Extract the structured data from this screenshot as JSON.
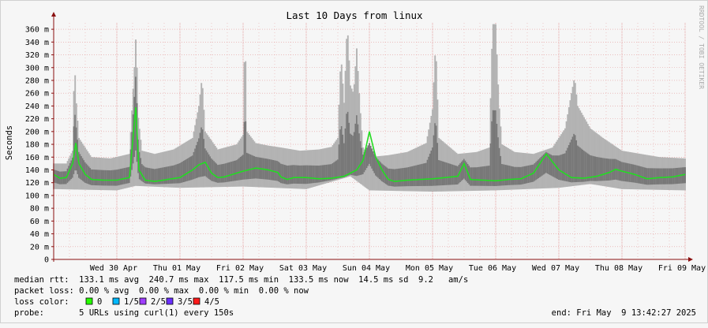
{
  "chart_data": {
    "type": "line",
    "title": "Last 10 Days from linux",
    "ylabel": "Seconds",
    "xlabel": "",
    "watermark": "RRDTOOL / TOBI OETIKER",
    "ylim": [
      0,
      370
    ],
    "y_ticks": [
      "0",
      "20 m",
      "40 m",
      "60 m",
      "80 m",
      "100 m",
      "120 m",
      "140 m",
      "160 m",
      "180 m",
      "200 m",
      "220 m",
      "240 m",
      "260 m",
      "280 m",
      "300 m",
      "320 m",
      "340 m",
      "360 m"
    ],
    "x_ticks": [
      "Wed 30 Apr",
      "Thu 01 May",
      "Fri 02 May",
      "Sat 03 May",
      "Sun 04 May",
      "Mon 05 May",
      "Tue 06 May",
      "Wed 07 May",
      "Thu 08 May",
      "Fri 09 May"
    ],
    "x_range_days": [
      0,
      10
    ],
    "grid": true,
    "colors": {
      "median": "#22dd22",
      "smoke_dark": "#777777",
      "smoke_light": "#b3b3b3",
      "grid": "#e39a9a",
      "axis": "#8a1010",
      "loss_0": "#26ff00",
      "loss_1_5": "#00b8ff",
      "loss_2_5": "#9f3eff",
      "loss_3_5": "#6a2fff",
      "loss_4_5": "#ff1a1a"
    },
    "series": [
      {
        "name": "median rtt",
        "x": [
          0,
          0.1,
          0.2,
          0.3,
          0.35,
          0.4,
          0.5,
          0.6,
          0.8,
          1.0,
          1.1,
          1.2,
          1.3,
          1.35,
          1.45,
          1.6,
          1.8,
          2.0,
          2.2,
          2.3,
          2.4,
          2.5,
          2.6,
          2.7,
          2.8,
          3.0,
          3.2,
          3.4,
          3.55,
          3.6,
          3.7,
          3.8,
          4.0,
          4.2,
          4.4,
          4.6,
          4.8,
          4.9,
          5.0,
          5.1,
          5.2,
          5.3,
          5.4,
          5.6,
          5.8,
          6.0,
          6.2,
          6.4,
          6.5,
          6.6,
          6.8,
          7.0,
          7.2,
          7.4,
          7.6,
          7.8,
          8.0,
          8.2,
          8.4,
          8.6,
          8.8,
          8.9,
          9.0,
          9.2,
          9.4,
          9.6,
          9.8,
          10.0
        ],
        "y": [
          133,
          127,
          128,
          150,
          182,
          150,
          133,
          125,
          124,
          124,
          126,
          128,
          238,
          140,
          124,
          122,
          125,
          128,
          140,
          148,
          152,
          135,
          128,
          129,
          132,
          138,
          143,
          140,
          136,
          129,
          125,
          128,
          128,
          126,
          127,
          130,
          140,
          155,
          200,
          160,
          140,
          125,
          122,
          124,
          125,
          126,
          128,
          130,
          150,
          125,
          124,
          123,
          125,
          126,
          135,
          165,
          140,
          128,
          127,
          130,
          136,
          141,
          138,
          133,
          126,
          128,
          129,
          133
        ]
      },
      {
        "name": "smoke max",
        "x": [
          0,
          0.2,
          0.3,
          0.33,
          0.36,
          0.4,
          0.6,
          0.9,
          1.2,
          1.29,
          1.31,
          1.33,
          1.4,
          1.6,
          1.9,
          2.2,
          2.3,
          2.35,
          2.4,
          2.6,
          2.9,
          3.0,
          3.03,
          3.06,
          3.2,
          3.4,
          3.6,
          3.9,
          4.2,
          4.4,
          4.5,
          4.55,
          4.6,
          4.65,
          4.7,
          4.75,
          4.8,
          4.85,
          4.9,
          5.0,
          5.3,
          5.6,
          5.9,
          6.0,
          6.05,
          6.1,
          6.4,
          6.7,
          6.9,
          6.95,
          7.0,
          7.05,
          7.1,
          7.3,
          7.6,
          7.9,
          8.1,
          8.2,
          8.25,
          8.3,
          8.5,
          8.7,
          9.0,
          9.3,
          9.6,
          10.0
        ],
        "y": [
          150,
          150,
          170,
          310,
          244,
          190,
          160,
          158,
          165,
          318,
          370,
          230,
          170,
          165,
          172,
          190,
          240,
          285,
          200,
          172,
          180,
          195,
          365,
          200,
          182,
          178,
          175,
          170,
          172,
          176,
          190,
          320,
          245,
          370,
          272,
          260,
          330,
          242,
          175,
          160,
          163,
          168,
          182,
          235,
          340,
          190,
          165,
          168,
          175,
          368,
          368,
          250,
          180,
          168,
          165,
          175,
          205,
          260,
          285,
          240,
          205,
          190,
          170,
          165,
          160,
          158
        ]
      },
      {
        "name": "smoke min",
        "x": [
          0,
          1,
          1.3,
          2,
          3,
          4,
          4.7,
          5,
          6,
          7,
          8,
          8.5,
          9,
          10
        ],
        "y": [
          110,
          108,
          115,
          112,
          114,
          110,
          130,
          108,
          106,
          108,
          112,
          118,
          110,
          108
        ]
      }
    ]
  },
  "legend": {
    "median_rtt": "median rtt:  133.1 ms avg  240.7 ms max  117.5 ms min  133.5 ms now  14.5 ms sd  9.2   am/s",
    "packet_loss": "packet loss: 0.00 % avg  0.00 % max  0.00 % min  0.00 % now",
    "loss_color_label": "loss color:",
    "loss_items": [
      "0",
      "1/5",
      "2/5",
      "3/5",
      "4/5"
    ],
    "probe": "probe:       5 URLs using curl(1) every 150s",
    "end": "end: Fri May  9 13:42:27 2025"
  }
}
